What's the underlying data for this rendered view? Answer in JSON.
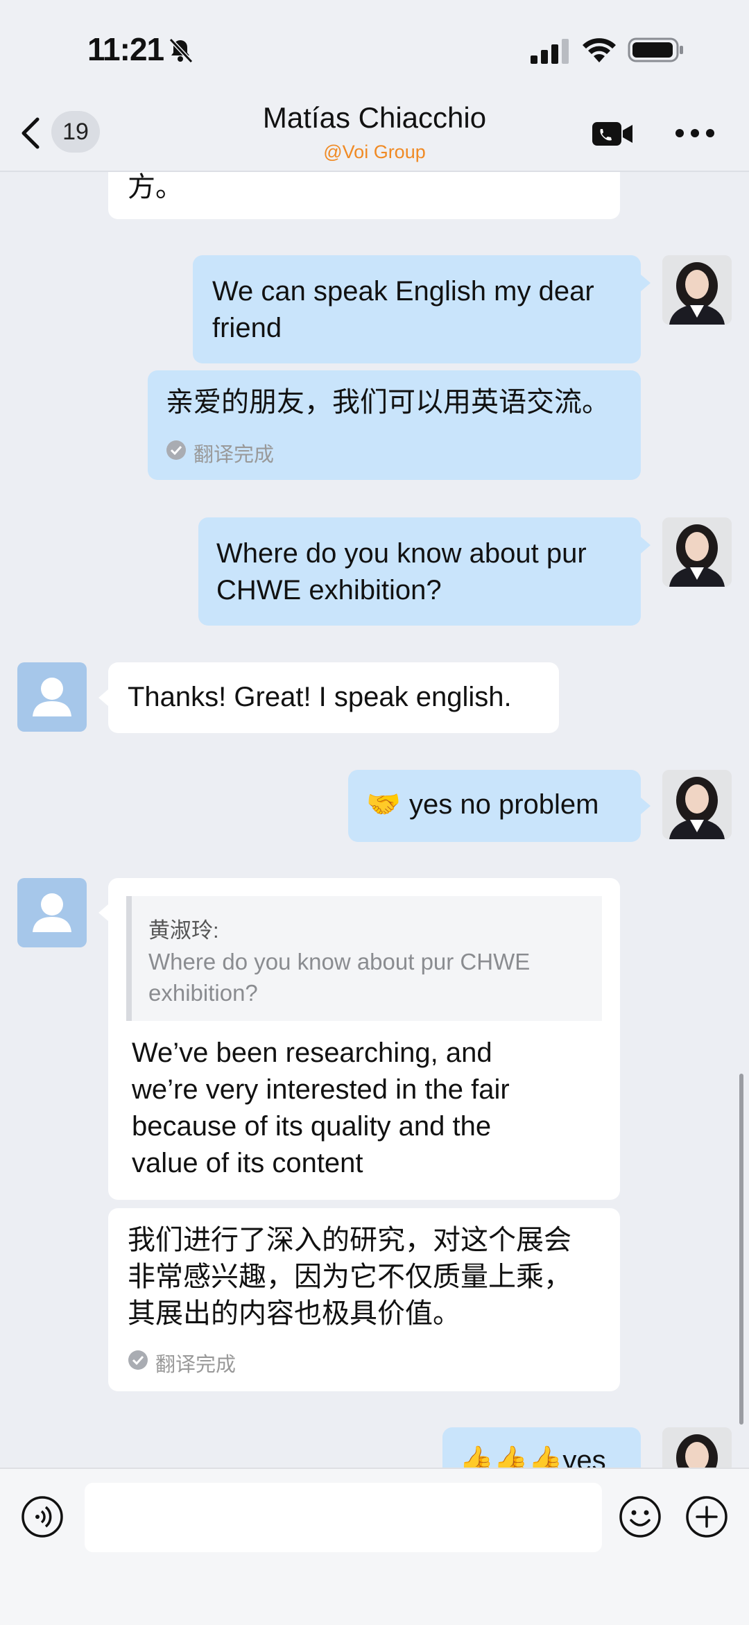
{
  "status_bar": {
    "time": "11:21"
  },
  "header": {
    "back_count": "19",
    "contact_name": "Matías Chiacchio",
    "contact_org": "@Voi Group"
  },
  "messages": {
    "m0_text": "方。",
    "m1_text": "We can speak English my dear\nfriend",
    "m1_translation": "亲爱的朋友，我们可以用英语交流。",
    "m1_status": "翻译完成",
    "m2_text": "Where do you know about pur\nCHWE exhibition?",
    "m3_text": "Thanks! Great! I speak english.",
    "m4_emoji": "🤝",
    "m4_text": "yes no problem",
    "m5_quote_author": "黄淑玲:",
    "m5_quote_text": "Where do you know about pur CHWE\nexhibition?",
    "m5_text": "We’ve been researching, and\nwe’re very interested in the fair\nbecause of its quality and the\nvalue of its content",
    "m5_translation": "我们进行了深入的研究，对这个展会\n非常感兴趣，因为它不仅质量上乘，\n其展出的内容也极具价值。",
    "m5_status": "翻译完成",
    "m6_text": "👍👍👍yes"
  },
  "input": {
    "placeholder": ""
  },
  "colors": {
    "outgoing_bubble": "#c9e4fb",
    "incoming_bubble": "#ffffff",
    "org_label": "#f08a24",
    "background": "#eceef3"
  },
  "icons": [
    "back-chevron-icon",
    "bell-slash-icon",
    "signal-icon",
    "wifi-icon",
    "battery-icon",
    "video-call-icon",
    "more-icon",
    "check-circle-icon",
    "voice-icon",
    "emoji-icon",
    "plus-icon",
    "default-avatar-icon"
  ]
}
